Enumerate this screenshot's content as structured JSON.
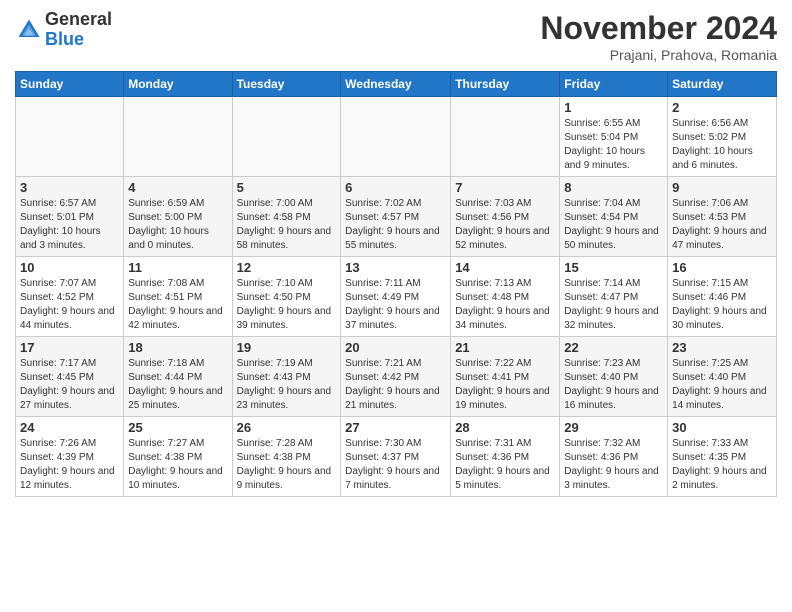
{
  "header": {
    "logo_general": "General",
    "logo_blue": "Blue",
    "month_title": "November 2024",
    "location": "Prajani, Prahova, Romania"
  },
  "weekdays": [
    "Sunday",
    "Monday",
    "Tuesday",
    "Wednesday",
    "Thursday",
    "Friday",
    "Saturday"
  ],
  "weeks": [
    {
      "row_class": "odd-row",
      "days": [
        {
          "date": "",
          "info": ""
        },
        {
          "date": "",
          "info": ""
        },
        {
          "date": "",
          "info": ""
        },
        {
          "date": "",
          "info": ""
        },
        {
          "date": "",
          "info": ""
        },
        {
          "date": "1",
          "info": "Sunrise: 6:55 AM\nSunset: 5:04 PM\nDaylight: 10 hours and 9 minutes."
        },
        {
          "date": "2",
          "info": "Sunrise: 6:56 AM\nSunset: 5:02 PM\nDaylight: 10 hours and 6 minutes."
        }
      ]
    },
    {
      "row_class": "even-row",
      "days": [
        {
          "date": "3",
          "info": "Sunrise: 6:57 AM\nSunset: 5:01 PM\nDaylight: 10 hours and 3 minutes."
        },
        {
          "date": "4",
          "info": "Sunrise: 6:59 AM\nSunset: 5:00 PM\nDaylight: 10 hours and 0 minutes."
        },
        {
          "date": "5",
          "info": "Sunrise: 7:00 AM\nSunset: 4:58 PM\nDaylight: 9 hours and 58 minutes."
        },
        {
          "date": "6",
          "info": "Sunrise: 7:02 AM\nSunset: 4:57 PM\nDaylight: 9 hours and 55 minutes."
        },
        {
          "date": "7",
          "info": "Sunrise: 7:03 AM\nSunset: 4:56 PM\nDaylight: 9 hours and 52 minutes."
        },
        {
          "date": "8",
          "info": "Sunrise: 7:04 AM\nSunset: 4:54 PM\nDaylight: 9 hours and 50 minutes."
        },
        {
          "date": "9",
          "info": "Sunrise: 7:06 AM\nSunset: 4:53 PM\nDaylight: 9 hours and 47 minutes."
        }
      ]
    },
    {
      "row_class": "odd-row",
      "days": [
        {
          "date": "10",
          "info": "Sunrise: 7:07 AM\nSunset: 4:52 PM\nDaylight: 9 hours and 44 minutes."
        },
        {
          "date": "11",
          "info": "Sunrise: 7:08 AM\nSunset: 4:51 PM\nDaylight: 9 hours and 42 minutes."
        },
        {
          "date": "12",
          "info": "Sunrise: 7:10 AM\nSunset: 4:50 PM\nDaylight: 9 hours and 39 minutes."
        },
        {
          "date": "13",
          "info": "Sunrise: 7:11 AM\nSunset: 4:49 PM\nDaylight: 9 hours and 37 minutes."
        },
        {
          "date": "14",
          "info": "Sunrise: 7:13 AM\nSunset: 4:48 PM\nDaylight: 9 hours and 34 minutes."
        },
        {
          "date": "15",
          "info": "Sunrise: 7:14 AM\nSunset: 4:47 PM\nDaylight: 9 hours and 32 minutes."
        },
        {
          "date": "16",
          "info": "Sunrise: 7:15 AM\nSunset: 4:46 PM\nDaylight: 9 hours and 30 minutes."
        }
      ]
    },
    {
      "row_class": "even-row",
      "days": [
        {
          "date": "17",
          "info": "Sunrise: 7:17 AM\nSunset: 4:45 PM\nDaylight: 9 hours and 27 minutes."
        },
        {
          "date": "18",
          "info": "Sunrise: 7:18 AM\nSunset: 4:44 PM\nDaylight: 9 hours and 25 minutes."
        },
        {
          "date": "19",
          "info": "Sunrise: 7:19 AM\nSunset: 4:43 PM\nDaylight: 9 hours and 23 minutes."
        },
        {
          "date": "20",
          "info": "Sunrise: 7:21 AM\nSunset: 4:42 PM\nDaylight: 9 hours and 21 minutes."
        },
        {
          "date": "21",
          "info": "Sunrise: 7:22 AM\nSunset: 4:41 PM\nDaylight: 9 hours and 19 minutes."
        },
        {
          "date": "22",
          "info": "Sunrise: 7:23 AM\nSunset: 4:40 PM\nDaylight: 9 hours and 16 minutes."
        },
        {
          "date": "23",
          "info": "Sunrise: 7:25 AM\nSunset: 4:40 PM\nDaylight: 9 hours and 14 minutes."
        }
      ]
    },
    {
      "row_class": "odd-row",
      "days": [
        {
          "date": "24",
          "info": "Sunrise: 7:26 AM\nSunset: 4:39 PM\nDaylight: 9 hours and 12 minutes."
        },
        {
          "date": "25",
          "info": "Sunrise: 7:27 AM\nSunset: 4:38 PM\nDaylight: 9 hours and 10 minutes."
        },
        {
          "date": "26",
          "info": "Sunrise: 7:28 AM\nSunset: 4:38 PM\nDaylight: 9 hours and 9 minutes."
        },
        {
          "date": "27",
          "info": "Sunrise: 7:30 AM\nSunset: 4:37 PM\nDaylight: 9 hours and 7 minutes."
        },
        {
          "date": "28",
          "info": "Sunrise: 7:31 AM\nSunset: 4:36 PM\nDaylight: 9 hours and 5 minutes."
        },
        {
          "date": "29",
          "info": "Sunrise: 7:32 AM\nSunset: 4:36 PM\nDaylight: 9 hours and 3 minutes."
        },
        {
          "date": "30",
          "info": "Sunrise: 7:33 AM\nSunset: 4:35 PM\nDaylight: 9 hours and 2 minutes."
        }
      ]
    }
  ]
}
